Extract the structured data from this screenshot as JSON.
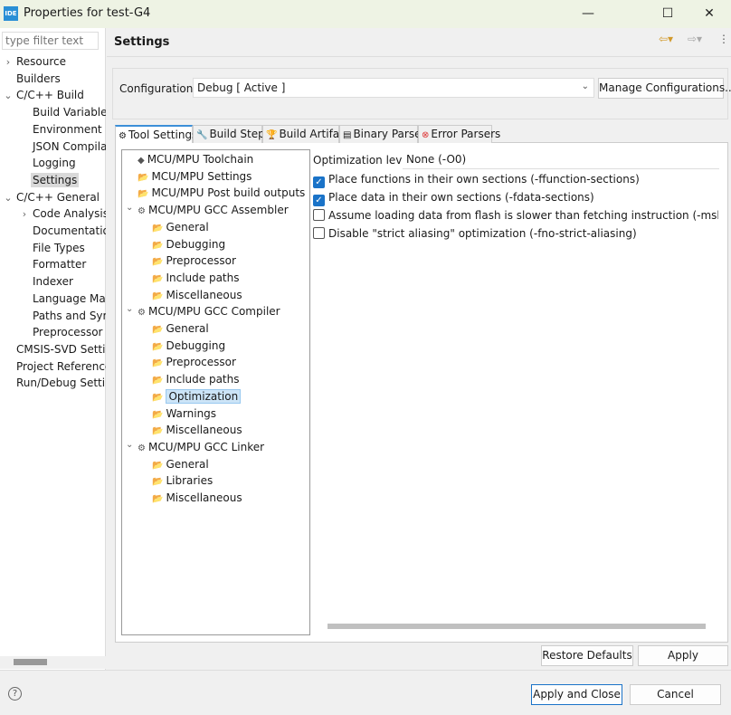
{
  "window": {
    "app_icon": "IDE",
    "title": "Properties for test-G4",
    "minimize": "—",
    "maximize": "☐",
    "close": "✕"
  },
  "sidebar": {
    "filter_placeholder": "type filter text",
    "items": [
      {
        "label": "Resource",
        "chev": "›",
        "indent": 0
      },
      {
        "label": "Builders",
        "chev": "",
        "indent": 0
      },
      {
        "label": "C/C++ Build",
        "chev": "⌄",
        "indent": 0
      },
      {
        "label": "Build Variables",
        "chev": "",
        "indent": 1
      },
      {
        "label": "Environment",
        "chev": "",
        "indent": 1
      },
      {
        "label": "JSON Compila",
        "chev": "",
        "indent": 1
      },
      {
        "label": "Logging",
        "chev": "",
        "indent": 1
      },
      {
        "label": "Settings",
        "chev": "",
        "indent": 1,
        "selected": true
      },
      {
        "label": "C/C++ General",
        "chev": "⌄",
        "indent": 0
      },
      {
        "label": "Code Analysis",
        "chev": "›",
        "indent": 1
      },
      {
        "label": "Documentatio",
        "chev": "",
        "indent": 1
      },
      {
        "label": "File Types",
        "chev": "",
        "indent": 1
      },
      {
        "label": "Formatter",
        "chev": "",
        "indent": 1
      },
      {
        "label": "Indexer",
        "chev": "",
        "indent": 1
      },
      {
        "label": "Language Map",
        "chev": "",
        "indent": 1
      },
      {
        "label": "Paths and Sym",
        "chev": "",
        "indent": 1
      },
      {
        "label": "Preprocessor I",
        "chev": "",
        "indent": 1
      },
      {
        "label": "CMSIS-SVD Settin",
        "chev": "",
        "indent": 0
      },
      {
        "label": "Project Reference",
        "chev": "",
        "indent": 0
      },
      {
        "label": "Run/Debug Settir",
        "chev": "",
        "indent": 0
      }
    ]
  },
  "header": {
    "title": "Settings"
  },
  "configuration": {
    "label": "Configuration:",
    "value": "Debug  [ Active ]",
    "manage_button": "Manage Configurations..."
  },
  "tabs": [
    {
      "label": "Tool Settings",
      "icon": "⚙",
      "active": true
    },
    {
      "label": "Build Steps",
      "icon": "🔧"
    },
    {
      "label": "Build Artifact",
      "icon": "🏆"
    },
    {
      "label": "Binary Parsers",
      "icon": "▤"
    },
    {
      "label": "Error Parsers",
      "icon": "⊗"
    }
  ],
  "tool_tree": [
    {
      "label": "MCU/MPU Toolchain",
      "level": 0,
      "icon": "◆"
    },
    {
      "label": "MCU/MPU Settings",
      "level": 0,
      "icon": "📂"
    },
    {
      "label": "MCU/MPU Post build outputs",
      "level": 0,
      "icon": "📂"
    },
    {
      "label": "MCU/MPU GCC Assembler",
      "level": 0,
      "icon": "⚙",
      "expanded": true
    },
    {
      "label": "General",
      "level": 1,
      "icon": "📂"
    },
    {
      "label": "Debugging",
      "level": 1,
      "icon": "📂"
    },
    {
      "label": "Preprocessor",
      "level": 1,
      "icon": "📂"
    },
    {
      "label": "Include paths",
      "level": 1,
      "icon": "📂"
    },
    {
      "label": "Miscellaneous",
      "level": 1,
      "icon": "📂"
    },
    {
      "label": "MCU/MPU GCC Compiler",
      "level": 0,
      "icon": "⚙",
      "expanded": true
    },
    {
      "label": "General",
      "level": 1,
      "icon": "📂"
    },
    {
      "label": "Debugging",
      "level": 1,
      "icon": "📂"
    },
    {
      "label": "Preprocessor",
      "level": 1,
      "icon": "📂"
    },
    {
      "label": "Include paths",
      "level": 1,
      "icon": "📂"
    },
    {
      "label": "Optimization",
      "level": 1,
      "icon": "📂",
      "selected": true
    },
    {
      "label": "Warnings",
      "level": 1,
      "icon": "📂"
    },
    {
      "label": "Miscellaneous",
      "level": 1,
      "icon": "📂"
    },
    {
      "label": "MCU/MPU GCC Linker",
      "level": 0,
      "icon": "⚙",
      "expanded": true
    },
    {
      "label": "General",
      "level": 1,
      "icon": "📂"
    },
    {
      "label": "Libraries",
      "level": 1,
      "icon": "📂"
    },
    {
      "label": "Miscellaneous",
      "level": 1,
      "icon": "📂"
    }
  ],
  "optimization": {
    "level_label": "Optimization level",
    "level_value": "None (-O0)",
    "options": [
      {
        "label": "Place functions in their own sections (-ffunction-sections)",
        "checked": true
      },
      {
        "label": "Place data in their own sections (-fdata-sections)",
        "checked": true
      },
      {
        "label": "Assume loading data from flash is slower than fetching instruction (-mslow-flash-data)",
        "checked": false
      },
      {
        "label": "Disable \"strict aliasing\" optimization (-fno-strict-aliasing)",
        "checked": false
      }
    ]
  },
  "buttons": {
    "restore_defaults": "Restore Defaults",
    "apply": "Apply",
    "apply_close": "Apply and Close",
    "cancel": "Cancel",
    "help": "?"
  }
}
